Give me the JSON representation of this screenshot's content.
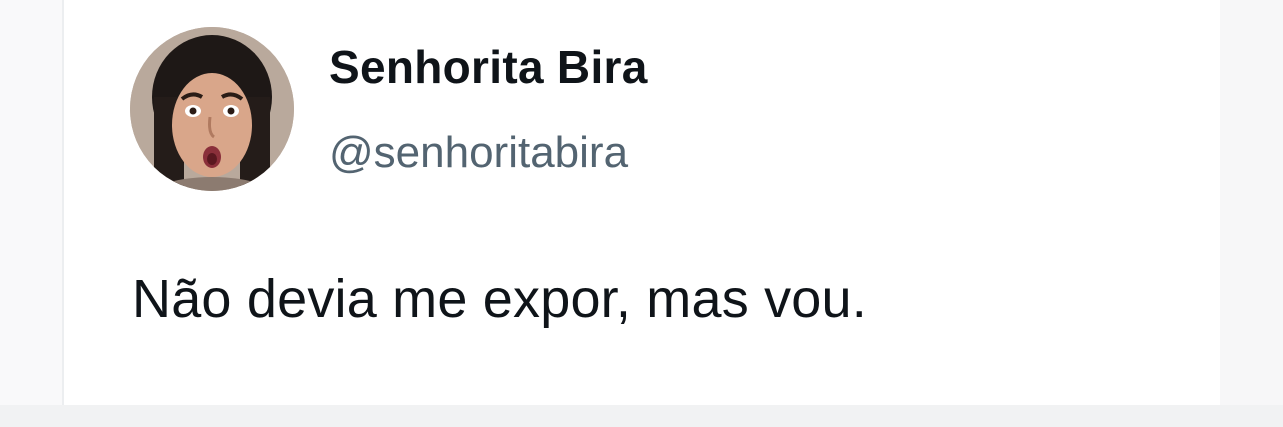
{
  "tweet": {
    "author": {
      "display_name": "Senhorita Bira",
      "handle": "@senhoritabira",
      "avatar_icon": "user-avatar-photo"
    },
    "text": "Não devia me expor, mas vou."
  },
  "colors": {
    "name": "#0f1419",
    "handle": "#536471",
    "background": "#ffffff"
  }
}
